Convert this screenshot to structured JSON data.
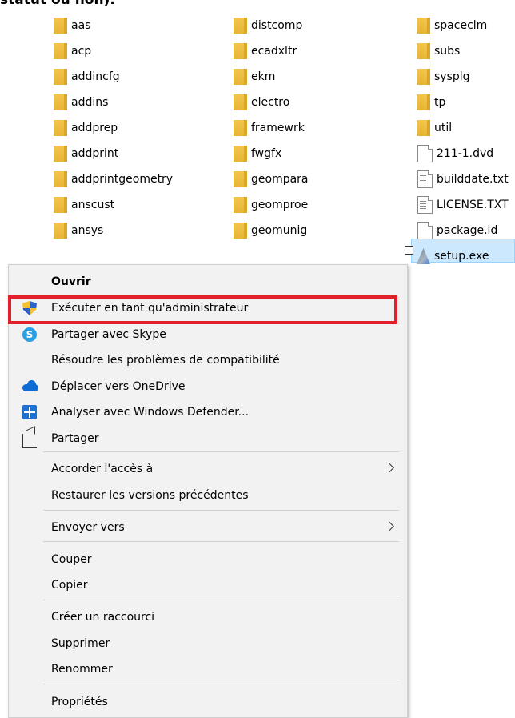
{
  "caption": "statut ou non).",
  "explorer": {
    "columns": [
      {
        "items": [
          {
            "name": "aas",
            "type": "folder"
          },
          {
            "name": "acp",
            "type": "folder"
          },
          {
            "name": "addincfg",
            "type": "folder"
          },
          {
            "name": "addins",
            "type": "folder"
          },
          {
            "name": "addprep",
            "type": "folder"
          },
          {
            "name": "addprint",
            "type": "folder"
          },
          {
            "name": "addprintgeometry",
            "type": "folder"
          },
          {
            "name": "anscust",
            "type": "folder"
          },
          {
            "name": "ansys",
            "type": "folder"
          }
        ]
      },
      {
        "items": [
          {
            "name": "distcomp",
            "type": "folder"
          },
          {
            "name": "ecadxltr",
            "type": "folder"
          },
          {
            "name": "ekm",
            "type": "folder"
          },
          {
            "name": "electro",
            "type": "folder"
          },
          {
            "name": "framewrk",
            "type": "folder"
          },
          {
            "name": "fwgfx",
            "type": "folder"
          },
          {
            "name": "geompara",
            "type": "folder"
          },
          {
            "name": "geomproe",
            "type": "folder"
          },
          {
            "name": "geomunig",
            "type": "folder"
          }
        ]
      },
      {
        "items": [
          {
            "name": "spaceclm",
            "type": "folder"
          },
          {
            "name": "subs",
            "type": "folder"
          },
          {
            "name": "sysplg",
            "type": "folder"
          },
          {
            "name": "tp",
            "type": "folder"
          },
          {
            "name": "util",
            "type": "folder"
          },
          {
            "name": "211-1.dvd",
            "type": "file"
          },
          {
            "name": "builddate.txt",
            "type": "text"
          },
          {
            "name": "LICENSE.TXT",
            "type": "text"
          },
          {
            "name": "package.id",
            "type": "file"
          },
          {
            "name": "setup.exe",
            "type": "exe"
          }
        ]
      }
    ]
  },
  "context_menu": {
    "items": [
      {
        "label": "Ouvrir",
        "bold": true
      },
      {
        "label": "Exécuter en tant qu'administrateur",
        "icon": "uac-shield-icon"
      },
      {
        "label": "Partager avec Skype",
        "icon": "skype-icon",
        "icon_text": "S"
      },
      {
        "label": "Résoudre les problèmes de compatibilité"
      },
      {
        "label": "Déplacer vers OneDrive",
        "icon": "onedrive-icon"
      },
      {
        "label": "Analyser avec Windows Defender...",
        "icon": "defender-icon"
      },
      {
        "label": "Partager",
        "icon": "share-icon"
      },
      {
        "label": "Accorder l'accès à",
        "submenu": true
      },
      {
        "label": "Restaurer les versions précédentes"
      },
      {
        "label": "Envoyer vers",
        "submenu": true
      },
      {
        "label": "Couper"
      },
      {
        "label": "Copier"
      },
      {
        "label": "Créer un raccourci"
      },
      {
        "label": "Supprimer"
      },
      {
        "label": "Renommer"
      },
      {
        "label": "Propriétés"
      }
    ]
  },
  "colors": {
    "highlight_box": "#e0212b",
    "selection": "#cce8ff",
    "menu_background": "#f2f2f2"
  }
}
